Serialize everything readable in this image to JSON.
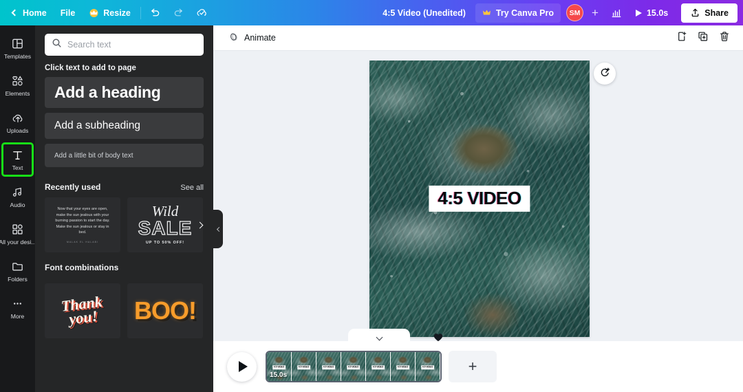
{
  "topbar": {
    "back_label": "",
    "home_label": "Home",
    "file_label": "File",
    "resize_label": "Resize",
    "undo_name": "undo-icon",
    "redo_name": "redo-icon",
    "cloud_name": "cloud-saved-icon",
    "doc_title": "4:5 Video (Unedited)",
    "pro_label": "Try Canva Pro",
    "avatar_initials": "SM",
    "add_member_label": "+",
    "insights_name": "insights-icon",
    "duration_label": "15.0s",
    "share_label": "Share",
    "gradient_start": "#00c4cc",
    "gradient_end": "#8b2be2",
    "avatar_color": "#f5484a"
  },
  "rail": {
    "items": [
      {
        "label": "Templates",
        "icon": "templates-icon",
        "active": false
      },
      {
        "label": "Elements",
        "icon": "elements-icon",
        "active": false
      },
      {
        "label": "Uploads",
        "icon": "uploads-icon",
        "active": false
      },
      {
        "label": "Text",
        "icon": "text-icon",
        "active": true
      },
      {
        "label": "Audio",
        "icon": "audio-icon",
        "active": false
      },
      {
        "label": "All your desi...",
        "icon": "all-designs-icon",
        "active": false
      },
      {
        "label": "Folders",
        "icon": "folders-icon",
        "active": false
      },
      {
        "label": "More",
        "icon": "more-icon",
        "active": false
      }
    ],
    "highlight_color": "#17e017"
  },
  "panel": {
    "search_placeholder": "Search text",
    "search_value": "",
    "hint": "Click text to add to page",
    "cards": [
      {
        "label": "Add a heading"
      },
      {
        "label": "Add a subheading"
      },
      {
        "label": "Add a little bit of body text"
      }
    ],
    "recently_used": {
      "title": "Recently used",
      "see_all": "See all",
      "items": [
        {
          "name": "quote-template",
          "quote": "Now that your eyes are open, make the sun jealous with your burning passion to start the day. Make the sun jealous or stay in bed.",
          "attribution": "MALAK EL HALABI"
        },
        {
          "name": "wild-sale-template",
          "line1": "Wild",
          "line2": "SALE",
          "line3": "UP TO 50% OFF!"
        }
      ]
    },
    "font_combinations": {
      "title": "Font combinations",
      "items": [
        {
          "name": "thank-you-combo",
          "line1": "Thank",
          "line2": "you!"
        },
        {
          "name": "boo-combo",
          "line1": "BOO!"
        }
      ]
    }
  },
  "canvas_toolbar": {
    "animate_label": "Animate",
    "add_page_icon": "add-page-icon",
    "duplicate_page_icon": "duplicate-page-icon",
    "delete_page_icon": "delete-page-icon"
  },
  "canvas": {
    "overlay_text": "4:5 VIDEO",
    "rotate_button_icon": "change-timing-icon"
  },
  "timeline": {
    "play_icon": "play-icon",
    "duration_badge": "15.0s",
    "frame_label": "4:5 VIDEO",
    "frame_count": 7,
    "add_page_label": "+",
    "collapse_icon": "chevron-down-icon",
    "heart_icon": "heart-icon"
  }
}
